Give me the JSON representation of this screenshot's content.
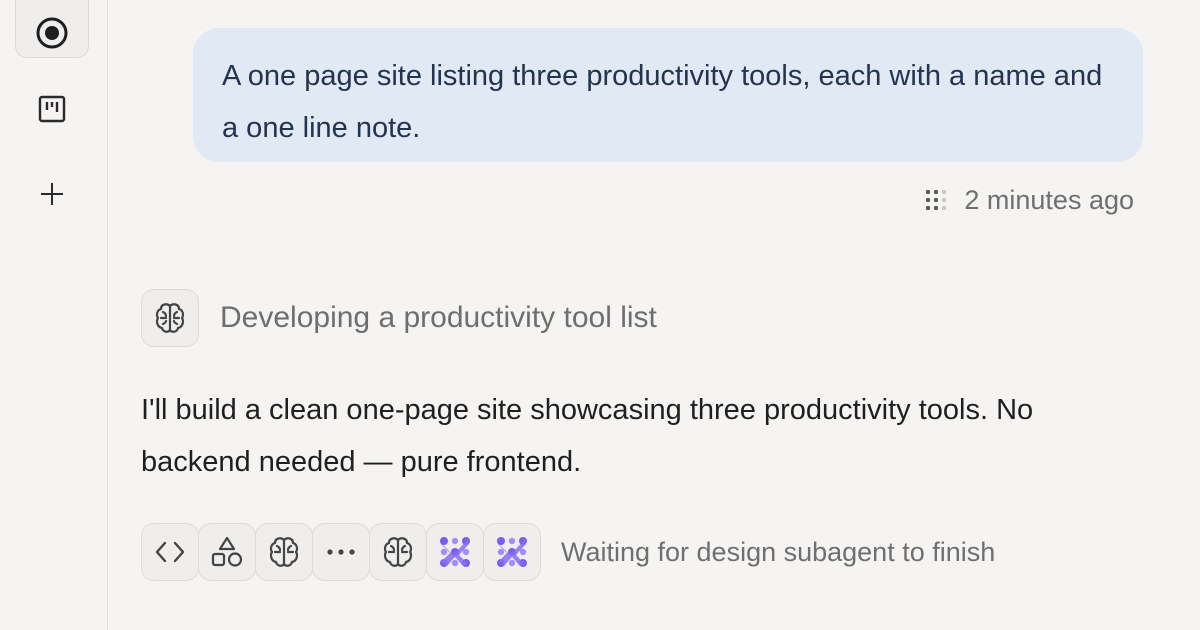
{
  "sidebar": {
    "items": [
      {
        "icon": "record-icon",
        "active": true
      },
      {
        "icon": "board-icon",
        "active": false
      },
      {
        "icon": "plus-icon",
        "active": false
      }
    ]
  },
  "user_message": {
    "text": "A one page site listing three productivity tools, each with a name and a one line note.",
    "timestamp": "2 minutes ago"
  },
  "thinking": {
    "icon": "brain-icon",
    "label": "Developing a productivity tool list"
  },
  "assistant_reply": {
    "text": "I'll build a clean one-page site showcasing three productivity tools. No backend needed — pure frontend."
  },
  "activity": {
    "icons": [
      "code-icon",
      "shapes-icon",
      "brain-icon",
      "more-icon",
      "brain-icon",
      "agent-icon",
      "agent-icon"
    ],
    "status": "Waiting for design subagent to finish"
  },
  "colors": {
    "background": "#f5f4f2",
    "user_bubble": "#e1e9f4",
    "agent_accent": "#7b5cf0"
  }
}
